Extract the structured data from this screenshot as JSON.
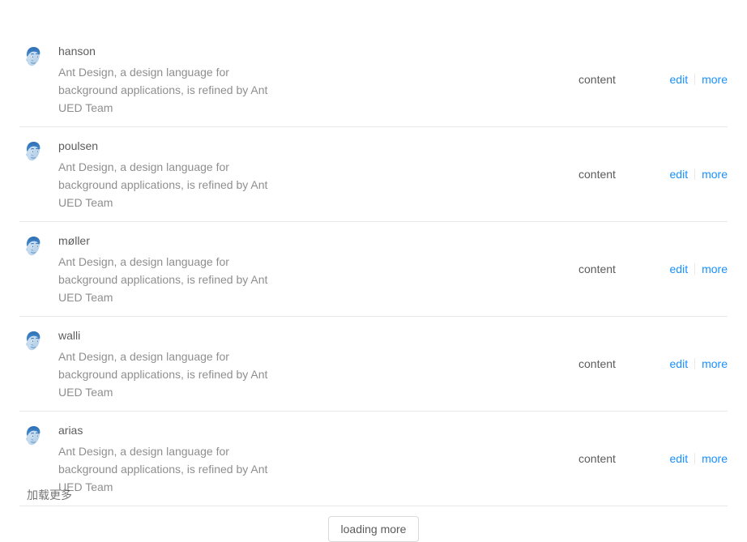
{
  "list": {
    "items": [
      {
        "name": "hanson",
        "description": "Ant Design, a design language for background applications, is refined by Ant UED Team",
        "content": "content",
        "avatar": "user-avatar-portrait",
        "actions": [
          {
            "label": "edit",
            "name": "edit-action"
          },
          {
            "label": "more",
            "name": "more-action"
          }
        ]
      },
      {
        "name": "poulsen",
        "description": "Ant Design, a design language for background applications, is refined by Ant UED Team",
        "content": "content",
        "avatar": "user-avatar-portrait",
        "actions": [
          {
            "label": "edit",
            "name": "edit-action"
          },
          {
            "label": "more",
            "name": "more-action"
          }
        ]
      },
      {
        "name": "møller",
        "description": "Ant Design, a design language for background applications, is refined by Ant UED Team",
        "content": "content",
        "avatar": "user-avatar-portrait",
        "actions": [
          {
            "label": "edit",
            "name": "edit-action"
          },
          {
            "label": "more",
            "name": "more-action"
          }
        ]
      },
      {
        "name": "walli",
        "description": "Ant Design, a design language for background applications, is refined by Ant UED Team",
        "content": "content",
        "avatar": "user-avatar-portrait",
        "actions": [
          {
            "label": "edit",
            "name": "edit-action"
          },
          {
            "label": "more",
            "name": "more-action"
          }
        ]
      },
      {
        "name": "arias",
        "description": "Ant Design, a design language for background applications, is refined by Ant UED Team",
        "content": "content",
        "avatar": "user-avatar-portrait",
        "actions": [
          {
            "label": "edit",
            "name": "edit-action"
          },
          {
            "label": "more",
            "name": "more-action"
          }
        ]
      }
    ]
  },
  "load_more": {
    "label": "loading more"
  },
  "footer": {
    "note": "加载更多"
  },
  "colors": {
    "link": "#1890ff",
    "border": "#e8e8e8",
    "button_border": "#d9d9d9",
    "text_primary": "rgba(0, 0, 0, 0.65)",
    "text_secondary": "rgba(0, 0, 0, 0.45)",
    "background": "#ffffff"
  }
}
